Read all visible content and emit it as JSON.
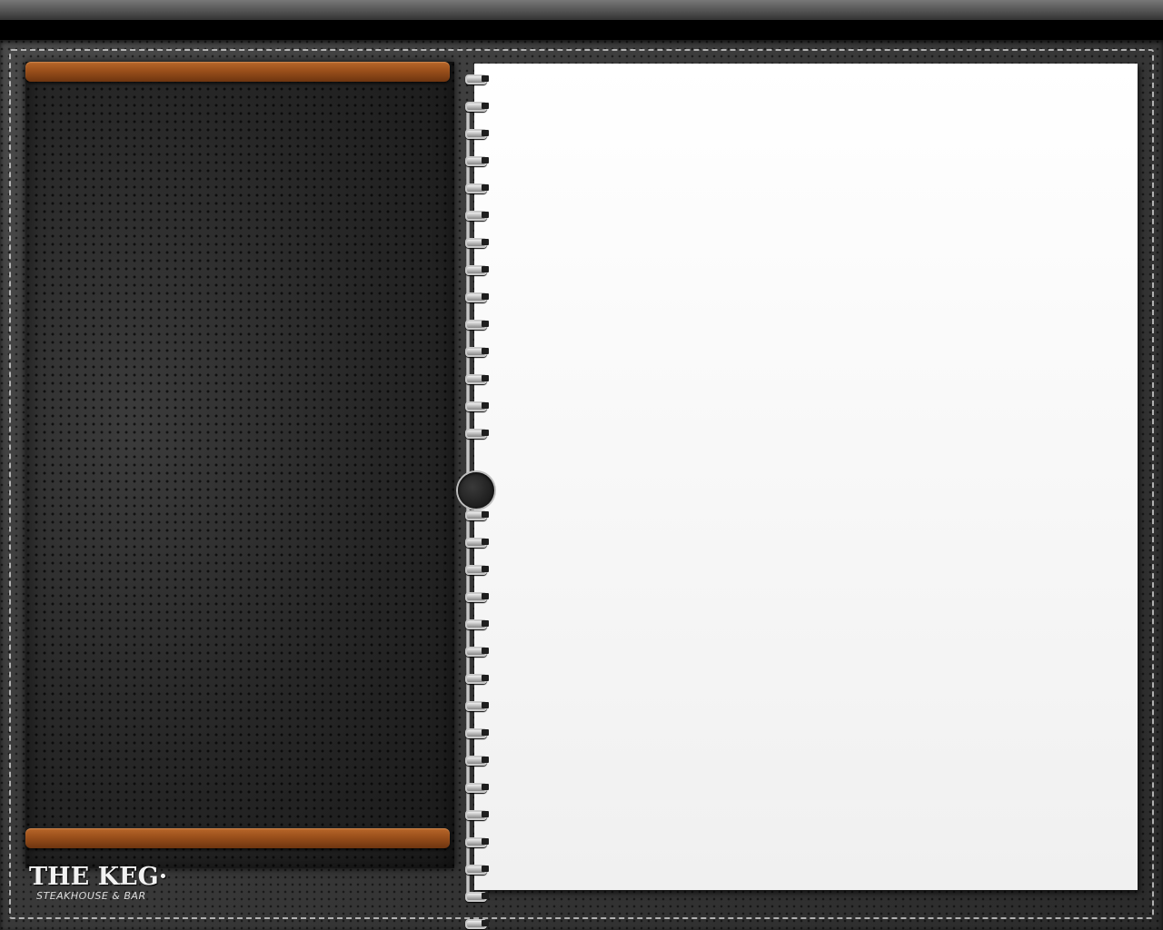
{
  "logo": {
    "main": "THE KEG",
    "mark": "·",
    "sub": "STEAKHOUSE & BAR"
  },
  "colors": {
    "leather": "#3a3a3a",
    "strap": "#9a4f1b",
    "paper": "#f8f8f8",
    "stitch": "#dcdcdc"
  },
  "spiral": {
    "icon": "spiral-binding-icon",
    "ring_count": 30
  }
}
